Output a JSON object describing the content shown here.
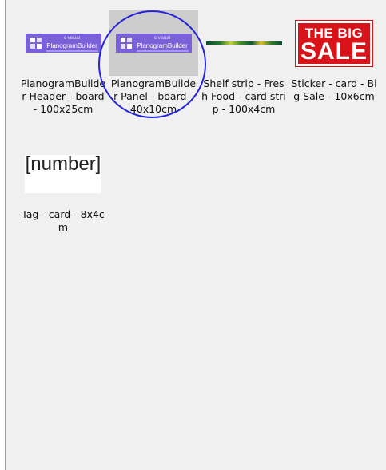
{
  "items": [
    {
      "caption": "PlanogramBuilder Header - board - 100x25cm",
      "thumb": "planogrambuilder-logo",
      "logo_small": "c visual",
      "logo_brand": "PlanogramBuilder",
      "selected": false
    },
    {
      "caption": "PlanogramBuilder Panel - board - 40x10cm",
      "thumb": "planogrambuilder-logo",
      "logo_small": "c visual",
      "logo_brand": "PlanogramBuilder",
      "selected": true
    },
    {
      "caption": "Shelf strip - Fresh Food - card strip - 100x4cm",
      "thumb": "shelf-strip",
      "selected": false
    },
    {
      "caption": "Sticker - card - Big Sale - 10x6cm",
      "thumb": "sale-sticker",
      "sale_line1": "THE BIG",
      "sale_line2": "SALE",
      "selected": false
    },
    {
      "caption": "Tag - card - 8x4cm",
      "thumb": "number-tag",
      "tag_text": "[number]",
      "selected": false
    }
  ],
  "colors": {
    "panel_bg": "#f0f0f0",
    "selection_bg": "#cdcdcd",
    "highlight_ring": "#2424d8",
    "planogram_purple": "#7b61d9",
    "sale_red": "#d8141a"
  }
}
